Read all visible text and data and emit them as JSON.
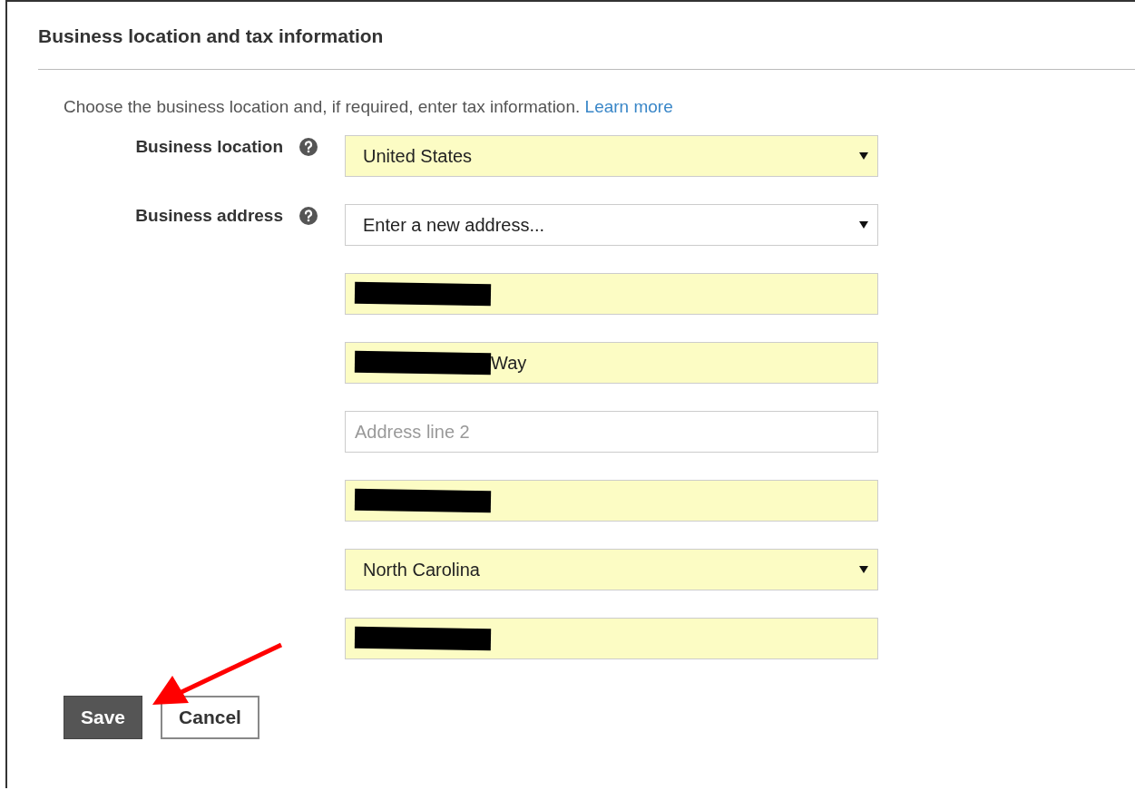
{
  "section": {
    "title": "Business location and tax information"
  },
  "intro": {
    "text": "Choose the business location and, if required, enter tax information.",
    "link": "Learn more"
  },
  "rows": [
    {
      "label": "Business location",
      "help": true,
      "field": {
        "kind": "select",
        "value": "United States",
        "autofilled": true,
        "redacted": false
      }
    },
    {
      "label": "Business address",
      "help": true,
      "field": {
        "kind": "select",
        "value": "Enter a new address...",
        "autofilled": false,
        "redacted": false
      }
    },
    {
      "field": {
        "kind": "text",
        "autofilled": true,
        "redacted": true
      }
    },
    {
      "field": {
        "kind": "text",
        "value": "Way",
        "autofilled": true,
        "redacted": true
      }
    },
    {
      "field": {
        "kind": "text",
        "placeholder": "Address line 2",
        "autofilled": false,
        "redacted": false
      }
    },
    {
      "field": {
        "kind": "text",
        "autofilled": true,
        "redacted": true
      }
    },
    {
      "field": {
        "kind": "select",
        "value": "North Carolina",
        "autofilled": true,
        "redacted": false
      }
    },
    {
      "field": {
        "kind": "text",
        "autofilled": true,
        "redacted": true
      }
    }
  ],
  "buttons": [
    {
      "label": "Save",
      "kind": "primary"
    },
    {
      "label": "Cancel",
      "kind": "secondary"
    }
  ]
}
